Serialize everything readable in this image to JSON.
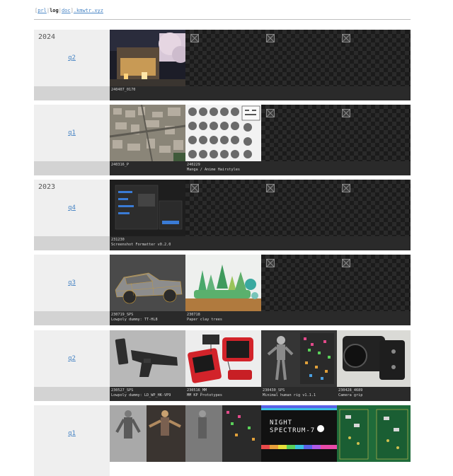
{
  "nav": {
    "pre": "[",
    "link1": "prl",
    "sep1": "|",
    "current": "log",
    "sep2": "|",
    "link2": "doc",
    "sep3": "]",
    "domain": ".kmwtr.xyz"
  },
  "rows": [
    {
      "year": "2024",
      "quarter": "q2",
      "tiles": [
        {
          "id": "240407_0170",
          "title": ""
        }
      ]
    },
    {
      "year": "",
      "quarter": "q1",
      "tiles": [
        {
          "id": "240316_P",
          "title": ""
        },
        {
          "id": "240229",
          "title": "Manga / Anime Hairstyles"
        }
      ]
    },
    {
      "year": "2023",
      "quarter": "q4",
      "tiles": [
        {
          "id": "231230",
          "title": "Screenshot Formatter v0.2.0"
        }
      ]
    },
    {
      "year": "",
      "quarter": "q3",
      "tiles": [
        {
          "id": "230719_SPS",
          "title": "Lowpoly dummy: TT-HL8"
        },
        {
          "id": "230718",
          "title": "Paper clay trees"
        }
      ]
    },
    {
      "year": "",
      "quarter": "q2",
      "tiles": [
        {
          "id": "230527_SPS",
          "title": "Lowpoly dummy: LD_WP_HK-VP9"
        },
        {
          "id": "230516_MM",
          "title": "MM KP Prototypes"
        },
        {
          "id": "230430_SPS",
          "title": "Minimal human rig v1.1.1"
        },
        {
          "id": "230428_4689",
          "title": "Camera grip"
        }
      ]
    },
    {
      "year": "",
      "quarter": "q1",
      "tiles": [
        {
          "id": "",
          "title": ""
        },
        {
          "id": "",
          "title": ""
        },
        {
          "id": "NIGHT SPECTRUM-7",
          "title": ""
        },
        {
          "id": "",
          "title": ""
        }
      ]
    }
  ],
  "colors": {
    "link": "#4a86c5",
    "sidebar": "#efefef",
    "sidebar_foot": "#d3d3d3",
    "caption_bg": "#2a2a2a"
  }
}
